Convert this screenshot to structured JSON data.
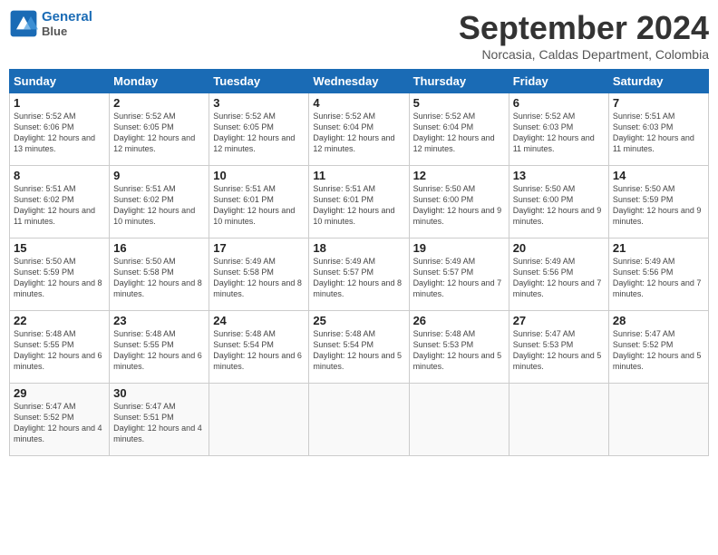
{
  "header": {
    "logo_line1": "General",
    "logo_line2": "Blue",
    "month": "September 2024",
    "location": "Norcasia, Caldas Department, Colombia"
  },
  "days_of_week": [
    "Sunday",
    "Monday",
    "Tuesday",
    "Wednesday",
    "Thursday",
    "Friday",
    "Saturday"
  ],
  "weeks": [
    [
      {
        "num": "1",
        "rise": "5:52 AM",
        "set": "6:06 PM",
        "daylight": "12 hours and 13 minutes."
      },
      {
        "num": "2",
        "rise": "5:52 AM",
        "set": "6:05 PM",
        "daylight": "12 hours and 12 minutes."
      },
      {
        "num": "3",
        "rise": "5:52 AM",
        "set": "6:05 PM",
        "daylight": "12 hours and 12 minutes."
      },
      {
        "num": "4",
        "rise": "5:52 AM",
        "set": "6:04 PM",
        "daylight": "12 hours and 12 minutes."
      },
      {
        "num": "5",
        "rise": "5:52 AM",
        "set": "6:04 PM",
        "daylight": "12 hours and 12 minutes."
      },
      {
        "num": "6",
        "rise": "5:52 AM",
        "set": "6:03 PM",
        "daylight": "12 hours and 11 minutes."
      },
      {
        "num": "7",
        "rise": "5:51 AM",
        "set": "6:03 PM",
        "daylight": "12 hours and 11 minutes."
      }
    ],
    [
      {
        "num": "8",
        "rise": "5:51 AM",
        "set": "6:02 PM",
        "daylight": "12 hours and 11 minutes."
      },
      {
        "num": "9",
        "rise": "5:51 AM",
        "set": "6:02 PM",
        "daylight": "12 hours and 10 minutes."
      },
      {
        "num": "10",
        "rise": "5:51 AM",
        "set": "6:01 PM",
        "daylight": "12 hours and 10 minutes."
      },
      {
        "num": "11",
        "rise": "5:51 AM",
        "set": "6:01 PM",
        "daylight": "12 hours and 10 minutes."
      },
      {
        "num": "12",
        "rise": "5:50 AM",
        "set": "6:00 PM",
        "daylight": "12 hours and 9 minutes."
      },
      {
        "num": "13",
        "rise": "5:50 AM",
        "set": "6:00 PM",
        "daylight": "12 hours and 9 minutes."
      },
      {
        "num": "14",
        "rise": "5:50 AM",
        "set": "5:59 PM",
        "daylight": "12 hours and 9 minutes."
      }
    ],
    [
      {
        "num": "15",
        "rise": "5:50 AM",
        "set": "5:59 PM",
        "daylight": "12 hours and 8 minutes."
      },
      {
        "num": "16",
        "rise": "5:50 AM",
        "set": "5:58 PM",
        "daylight": "12 hours and 8 minutes."
      },
      {
        "num": "17",
        "rise": "5:49 AM",
        "set": "5:58 PM",
        "daylight": "12 hours and 8 minutes."
      },
      {
        "num": "18",
        "rise": "5:49 AM",
        "set": "5:57 PM",
        "daylight": "12 hours and 8 minutes."
      },
      {
        "num": "19",
        "rise": "5:49 AM",
        "set": "5:57 PM",
        "daylight": "12 hours and 7 minutes."
      },
      {
        "num": "20",
        "rise": "5:49 AM",
        "set": "5:56 PM",
        "daylight": "12 hours and 7 minutes."
      },
      {
        "num": "21",
        "rise": "5:49 AM",
        "set": "5:56 PM",
        "daylight": "12 hours and 7 minutes."
      }
    ],
    [
      {
        "num": "22",
        "rise": "5:48 AM",
        "set": "5:55 PM",
        "daylight": "12 hours and 6 minutes."
      },
      {
        "num": "23",
        "rise": "5:48 AM",
        "set": "5:55 PM",
        "daylight": "12 hours and 6 minutes."
      },
      {
        "num": "24",
        "rise": "5:48 AM",
        "set": "5:54 PM",
        "daylight": "12 hours and 6 minutes."
      },
      {
        "num": "25",
        "rise": "5:48 AM",
        "set": "5:54 PM",
        "daylight": "12 hours and 5 minutes."
      },
      {
        "num": "26",
        "rise": "5:48 AM",
        "set": "5:53 PM",
        "daylight": "12 hours and 5 minutes."
      },
      {
        "num": "27",
        "rise": "5:47 AM",
        "set": "5:53 PM",
        "daylight": "12 hours and 5 minutes."
      },
      {
        "num": "28",
        "rise": "5:47 AM",
        "set": "5:52 PM",
        "daylight": "12 hours and 5 minutes."
      }
    ],
    [
      {
        "num": "29",
        "rise": "5:47 AM",
        "set": "5:52 PM",
        "daylight": "12 hours and 4 minutes."
      },
      {
        "num": "30",
        "rise": "5:47 AM",
        "set": "5:51 PM",
        "daylight": "12 hours and 4 minutes."
      },
      null,
      null,
      null,
      null,
      null
    ]
  ],
  "labels": {
    "sunrise": "Sunrise:",
    "sunset": "Sunset:",
    "daylight": "Daylight:"
  }
}
